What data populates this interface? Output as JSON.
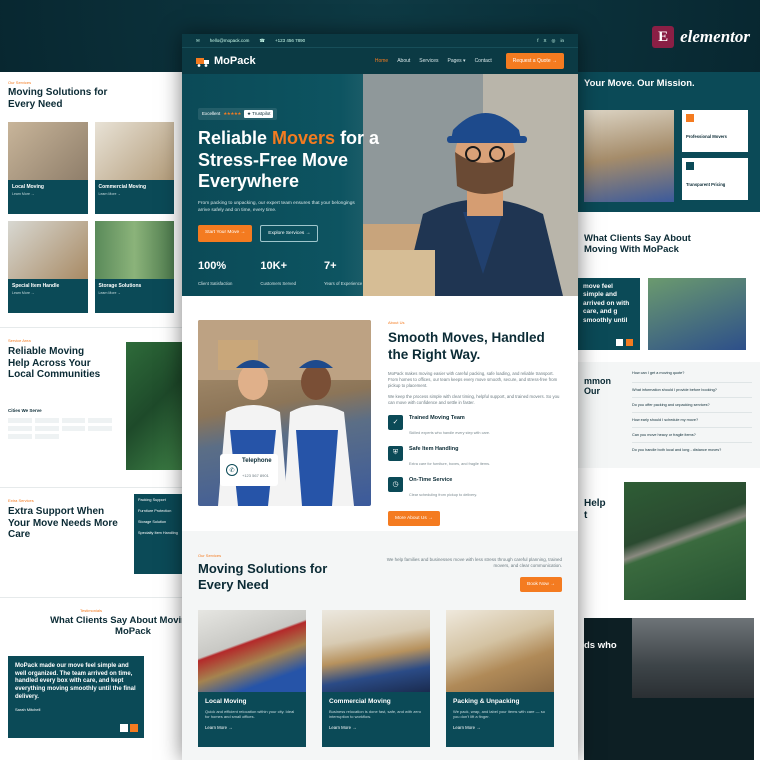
{
  "brand_badge": "E",
  "brand_word": "elementor",
  "topbar": {
    "email": "hello@mopack.com",
    "phone": "+123 456 7890",
    "social": [
      "f",
      "X",
      "◎",
      "in"
    ]
  },
  "nav": {
    "brand": "MoPack",
    "items": [
      "Home",
      "About",
      "Services",
      "Pages ▾",
      "Contact"
    ],
    "quote": "Request a Quote →"
  },
  "hero": {
    "rating_label": "Excellent",
    "stars": "★★★★★",
    "trustpilot": "★ Trustpilot",
    "title_a": "Reliable ",
    "title_hl": "Movers",
    "title_b": " for a Stress-Free Move Everywhere",
    "sub": "From packing to unpacking, our expert team ensures that your belongings arrive safely and on time, every time.",
    "btn_primary": "Start Your Move →",
    "btn_secondary": "Explore Services →",
    "stats": [
      {
        "value": "100%",
        "label": "Client Satisfaction"
      },
      {
        "value": "10K+",
        "label": "Customers Served"
      },
      {
        "value": "7+",
        "label": "Years of Experience"
      }
    ]
  },
  "about": {
    "tag": "About Us",
    "title": "Smooth Moves, Handled the Right Way.",
    "p1": "MoPack makes moving easier with careful packing, safe loading, and reliable transport. From homes to offices, our team keeps every move smooth, secure, and stress-free from pickup to placement.",
    "p2": "We keep the process simple with clear timing, helpful support, and trained movers. So you can move with confidence and settle in faster.",
    "features": [
      {
        "title": "Trained Moving Team",
        "desc": "Skilled experts who handle every step with care."
      },
      {
        "title": "Safe Item Handling",
        "desc": "Extra care for furniture, boxes, and fragile items."
      },
      {
        "title": "On-Time Service",
        "desc": "Clear scheduling from pickup to delivery."
      }
    ],
    "btn": "More About Us →",
    "phone_title": "Telephone",
    "phone_number": "+123 567 8901"
  },
  "services": {
    "tag": "Our Services",
    "title": "Moving Solutions for Every Need",
    "intro": "We help families and businesses move with less stress through careful planning, trained movers, and clear communication.",
    "btn": "Book Now →",
    "cards": [
      {
        "title": "Local Moving",
        "desc": "Quick and efficient relocation within your city. Ideal for homes and small offices.",
        "link": "Learn More →"
      },
      {
        "title": "Commercial Moving",
        "desc": "Business relocation is done fast, safe, and with zero interruption to workflow.",
        "link": "Learn More →"
      },
      {
        "title": "Packing & Unpacking",
        "desc": "We pack, wrap, and label your items with care — so you don't lift a finger.",
        "link": "Learn More →"
      }
    ]
  },
  "left_panel": {
    "tag1": "Our Services",
    "title1": "Moving Solutions for Every Need",
    "cards": [
      {
        "title": "Local Moving",
        "link": "Learn More →"
      },
      {
        "title": "Commercial Moving",
        "link": "Learn More →"
      },
      {
        "title": "Special Item Handle",
        "link": "Learn More →"
      },
      {
        "title": "Storage Solutions",
        "link": "Learn More →"
      }
    ],
    "tag2": "Service Area",
    "title2": "Reliable Moving Help Across Your Local Communities",
    "cities_label": "Cities We Serve",
    "tag3": "Extra Services",
    "title3": "Extra Support When Your Move Needs More Care",
    "extras": [
      "Packing Support",
      "Furniture Protection",
      "Storage Solution",
      "Specialty Item Handling"
    ],
    "tag4": "Testimonials",
    "title4": "What Clients Say About Moving With MoPack",
    "quote": "MoPack made our move feel simple and well organized. The team arrived on time, handled every box with care, and kept everything moving smoothly until the final delivery.",
    "author": "Sarah Mitchell"
  },
  "right_panel": {
    "title1": "Your Move. Our Mission.",
    "box1": "Professional Movers",
    "box2": "Transparent Pricing",
    "title2": "What Clients Say About Moving With MoPack",
    "quote": "move feel simple and arrived on with care, and g smoothly until",
    "faq_title_a": "mmon",
    "faq_title_b": "Our",
    "faqs": [
      "How can I get a moving quote?",
      "What information should I provide before booking?",
      "Do you offer packing and unpacking services?",
      "How early should I schedule my move?",
      "Can you move heavy or fragile items?",
      "Do you handle both local and long - distance moves?"
    ],
    "title3_a": "Help",
    "title3_b": "t",
    "title4": "ds who"
  }
}
